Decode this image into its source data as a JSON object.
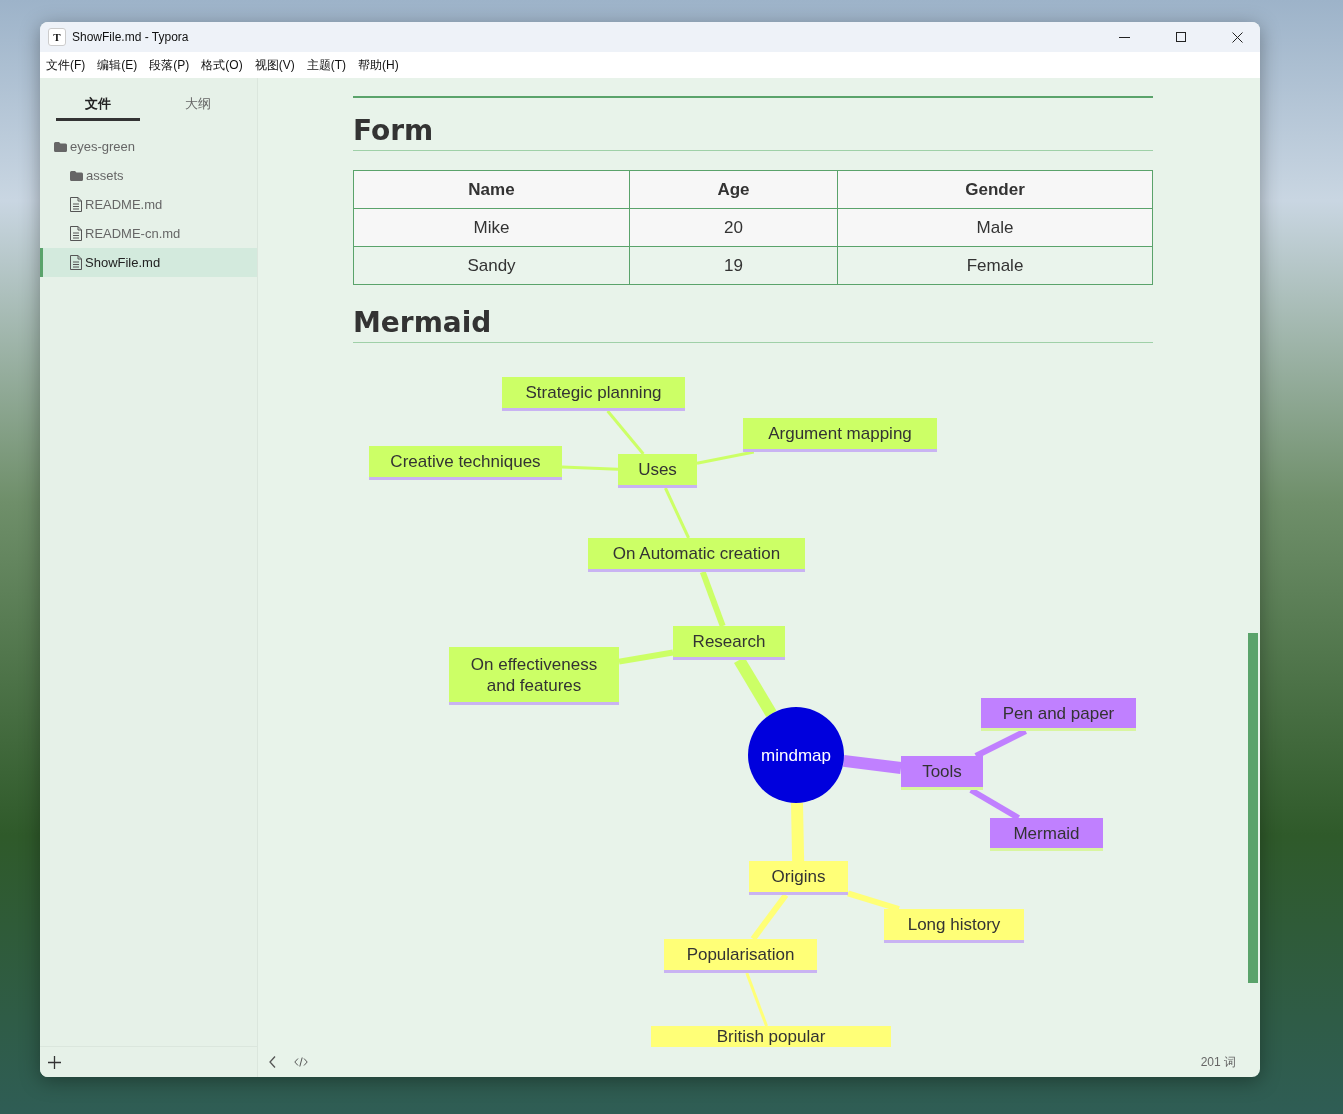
{
  "window": {
    "app_icon": "T",
    "title": "ShowFile.md - Typora"
  },
  "menu": [
    "文件(F)",
    "编辑(E)",
    "段落(P)",
    "格式(O)",
    "视图(V)",
    "主题(T)",
    "帮助(H)"
  ],
  "sidebar": {
    "tabs": [
      {
        "label": "文件",
        "selected": true
      },
      {
        "label": "大纲",
        "selected": false
      }
    ],
    "files": [
      {
        "kind": "folder",
        "name": "eyes-green",
        "selected": false,
        "children": [
          {
            "kind": "folder",
            "name": "assets",
            "selected": false
          },
          {
            "kind": "file",
            "name": "README.md",
            "selected": false
          },
          {
            "kind": "file",
            "name": "README-cn.md",
            "selected": false
          },
          {
            "kind": "file",
            "name": "ShowFile.md",
            "selected": true
          }
        ]
      }
    ]
  },
  "document": {
    "form_heading": "Form",
    "table": {
      "columns": [
        "Name",
        "Age",
        "Gender"
      ],
      "rows": [
        [
          "Mike",
          "20",
          "Male"
        ],
        [
          "Sandy",
          "19",
          "Female"
        ]
      ]
    },
    "mermaid_heading": "Mermaid",
    "mindmap": {
      "label": "mindmap",
      "color": "#0000dd",
      "children": [
        {
          "label": "Research",
          "color": "#ccff66",
          "children": [
            {
              "label": "On effectiveness and features"
            },
            {
              "label": "On Automatic creation",
              "children": [
                {
                  "label": "Uses",
                  "children": [
                    {
                      "label": "Creative techniques"
                    },
                    {
                      "label": "Strategic planning"
                    },
                    {
                      "label": "Argument mapping"
                    }
                  ]
                }
              ]
            }
          ]
        },
        {
          "label": "Tools",
          "color": "#c080ff",
          "children": [
            {
              "label": "Pen and paper"
            },
            {
              "label": "Mermaid"
            }
          ]
        },
        {
          "label": "Origins",
          "color": "#ffff77",
          "children": [
            {
              "label": "Long history"
            },
            {
              "label": "Popularisation",
              "children": [
                {
                  "label": "British popular"
                }
              ]
            }
          ]
        }
      ]
    }
  },
  "status_bar": {
    "word_count": "201 词"
  }
}
